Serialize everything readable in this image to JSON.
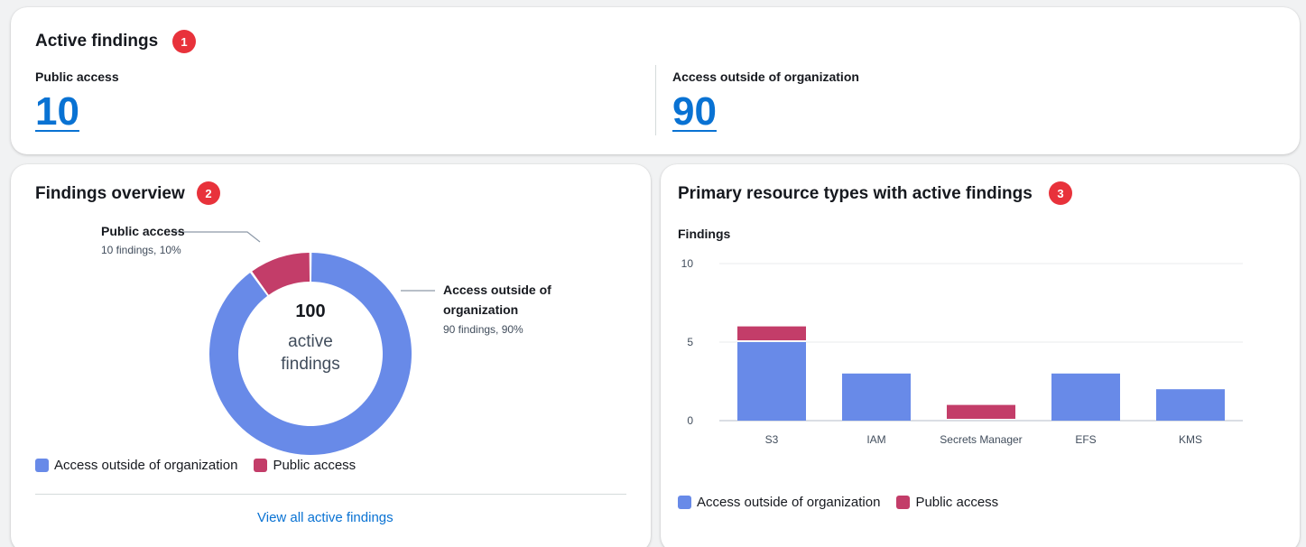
{
  "colors": {
    "outside_org": "#688ae8",
    "public_access": "#c33d69",
    "link": "#0972d3",
    "badge": "#e8323b"
  },
  "active_findings": {
    "title": "Active findings",
    "badge": "1",
    "public_access": {
      "label": "Public access",
      "value": "10"
    },
    "outside_org": {
      "label": "Access outside of organization",
      "value": "90"
    }
  },
  "findings_overview": {
    "title": "Findings overview",
    "badge": "2",
    "center_value": "100",
    "center_line1": "active",
    "center_line2": "findings",
    "callout_public": {
      "label": "Public access",
      "detail": "10 findings, 10%"
    },
    "callout_outside": {
      "label_line1": "Access outside of",
      "label_line2": "organization",
      "detail": "90 findings, 90%"
    },
    "legend": {
      "outside_org": "Access outside of organization",
      "public_access": "Public access"
    },
    "view_all_link": "View all active findings"
  },
  "resource_types": {
    "title": "Primary resource types with active findings",
    "badge": "3",
    "y_axis_title": "Findings",
    "legend": {
      "outside_org": "Access outside of organization",
      "public_access": "Public access"
    }
  },
  "chart_data": [
    {
      "type": "pie",
      "variant": "donut",
      "categories": [
        "Access outside of organization",
        "Public access"
      ],
      "values": [
        90,
        10
      ],
      "center_text": "100 active findings"
    },
    {
      "type": "bar",
      "stacked": true,
      "categories": [
        "S3",
        "IAM",
        "Secrets Manager",
        "EFS",
        "KMS"
      ],
      "series": [
        {
          "name": "Access outside of organization",
          "values": [
            5,
            3,
            0,
            3,
            2
          ]
        },
        {
          "name": "Public access",
          "values": [
            1,
            0,
            1,
            0,
            0
          ]
        }
      ],
      "ylabel": "Findings",
      "ylim": [
        0,
        10
      ],
      "yticks": [
        "0",
        "5",
        "10"
      ],
      "grid": true,
      "legend_position": "bottom-left"
    }
  ]
}
